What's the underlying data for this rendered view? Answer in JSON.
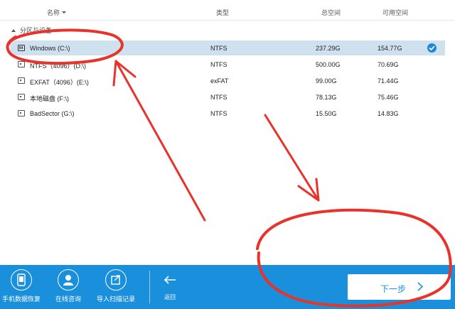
{
  "header": {
    "columns": {
      "name": "名称",
      "type": "类型",
      "total": "总空间",
      "free": "可用空间"
    }
  },
  "section": {
    "title": "分区与设备"
  },
  "partitions": [
    {
      "name": "Windows (C:\\)",
      "type": "NTFS",
      "total": "237.29G",
      "free": "154.77G",
      "selected": true,
      "icon": "system-drive-icon"
    },
    {
      "name": "NTFS（4096）(D:\\)",
      "type": "NTFS",
      "total": "500.00G",
      "free": "70.69G",
      "selected": false,
      "icon": "drive-icon"
    },
    {
      "name": "EXFAT（4096）(E:\\)",
      "type": "exFAT",
      "total": "99.00G",
      "free": "71.44G",
      "selected": false,
      "icon": "drive-icon"
    },
    {
      "name": "本地磁盘 (F:\\)",
      "type": "NTFS",
      "total": "78.13G",
      "free": "75.46G",
      "selected": false,
      "icon": "drive-icon"
    },
    {
      "name": "BadSector (G:\\)",
      "type": "NTFS",
      "total": "15.50G",
      "free": "14.83G",
      "selected": false,
      "icon": "drive-icon"
    }
  ],
  "footer": {
    "phone_recovery": "手机数据恢复",
    "online_consult": "在线咨询",
    "import_scan": "导入扫描记录",
    "back": "返回",
    "next": "下一步"
  },
  "colors": {
    "accent": "#1a8fdc",
    "selected_row": "#cfe1ef",
    "annotation": "#e8332a"
  }
}
